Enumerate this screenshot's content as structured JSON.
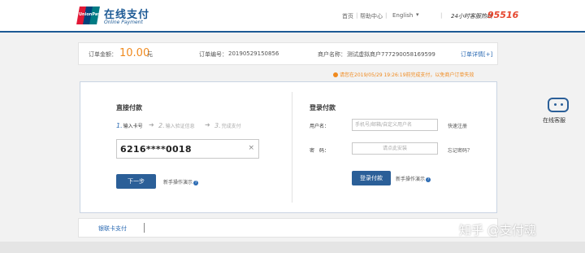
{
  "header": {
    "logo_text": "UnionPay 银联",
    "brand_cn": "在线支付",
    "brand_en": "Online Payment",
    "nav": [
      "首页",
      "帮助中心",
      "English"
    ],
    "hotline_label": "24小时客服热线",
    "hotline_number": "95516"
  },
  "order": {
    "amount_label": "订单金额：",
    "amount": "10.00",
    "currency": "元",
    "order_no_label": "订单编号：",
    "order_no": "20190529150856",
    "merchant_label": "商户名称：",
    "merchant": "测试虚拟商户777290058169599",
    "detail_link": "订单详情[+]"
  },
  "warning": "请您在2019/05/29 19:26:19前完成支付，以免商户订单失效",
  "direct_pay": {
    "title": "直接付款",
    "steps": [
      {
        "num": "1.",
        "label": "输入卡号"
      },
      {
        "num": "2.",
        "label": "输入验证信息"
      },
      {
        "num": "3.",
        "label": "完成支付"
      }
    ],
    "card_number": "6216****0018",
    "clear_symbol": "×",
    "next_button": "下一步",
    "help_link": "新手操作演示"
  },
  "login_pay": {
    "title": "登录付款",
    "username_label": "用户名：",
    "username_placeholder": "手机号/邮箱/自定义用户名",
    "register_link": "快速注册",
    "password_label": "密　码：",
    "password_placeholder": "请点此安装",
    "forgot_link": "忘记密码？",
    "login_button": "登录付款",
    "help_link": "新手操作演示"
  },
  "service": {
    "label": "在线客服"
  },
  "footer": {
    "bank_card_link": "银联卡支付"
  },
  "watermark": "知乎 @支付魂"
}
